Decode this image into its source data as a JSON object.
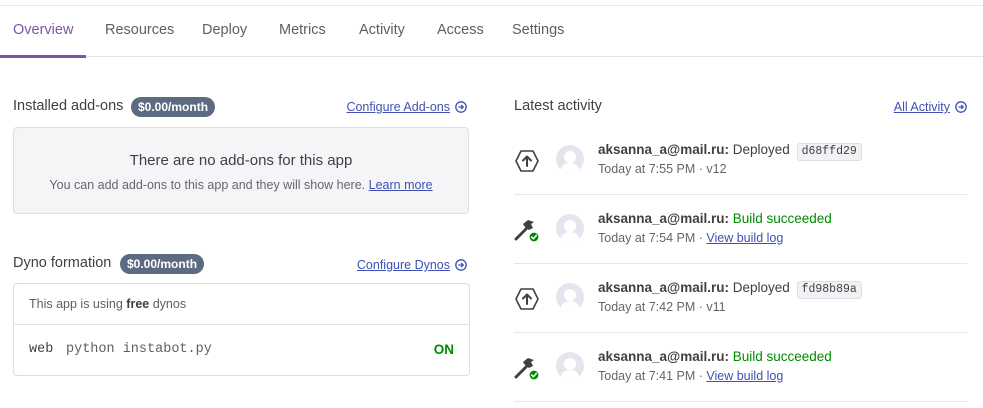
{
  "nav": {
    "tabs": [
      {
        "label": "Overview",
        "active": true
      },
      {
        "label": "Resources",
        "active": false
      },
      {
        "label": "Deploy",
        "active": false
      },
      {
        "label": "Metrics",
        "active": false
      },
      {
        "label": "Activity",
        "active": false
      },
      {
        "label": "Access",
        "active": false
      },
      {
        "label": "Settings",
        "active": false
      }
    ]
  },
  "addons": {
    "title": "Installed add-ons",
    "cost_badge": "$0.00/month",
    "configure_link": "Configure Add-ons",
    "empty_title": "There are no add-ons for this app",
    "empty_text": "You can add add-ons to this app and they will show here.",
    "learn_more": "Learn more"
  },
  "dynos": {
    "title": "Dyno formation",
    "cost_badge": "$0.00/month",
    "configure_link": "Configure Dynos",
    "info_prefix": "This app is using",
    "info_tier": "free",
    "info_suffix": "dynos",
    "process": {
      "type": "web",
      "command": "python instabot.py",
      "state": "ON"
    }
  },
  "activity": {
    "title": "Latest activity",
    "all_link": "All Activity",
    "items": [
      {
        "kind": "deploy-icon",
        "user": "aksanna_a@mail.ru:",
        "action": "Deployed",
        "commit": "d68ffd29",
        "time": "Today at 7:55 PM",
        "sep": " · ",
        "detail": "v12"
      },
      {
        "kind": "build-icon",
        "user": "aksanna_a@mail.ru:",
        "action": "Build succeeded",
        "time": "Today at 7:54 PM",
        "sep": " · ",
        "link": "View build log"
      },
      {
        "kind": "deploy-icon",
        "user": "aksanna_a@mail.ru:",
        "action": "Deployed",
        "commit": "fd98b89a",
        "time": "Today at 7:42 PM",
        "sep": " · ",
        "detail": "v11"
      },
      {
        "kind": "build-icon",
        "user": "aksanna_a@mail.ru:",
        "action": "Build succeeded",
        "time": "Today at 7:41 PM",
        "sep": " · ",
        "link": "View build log"
      }
    ]
  },
  "colors": {
    "accent": "#79589f",
    "link": "#3f51b5",
    "success": "#008a00",
    "badge_bg": "#5d6b82"
  }
}
